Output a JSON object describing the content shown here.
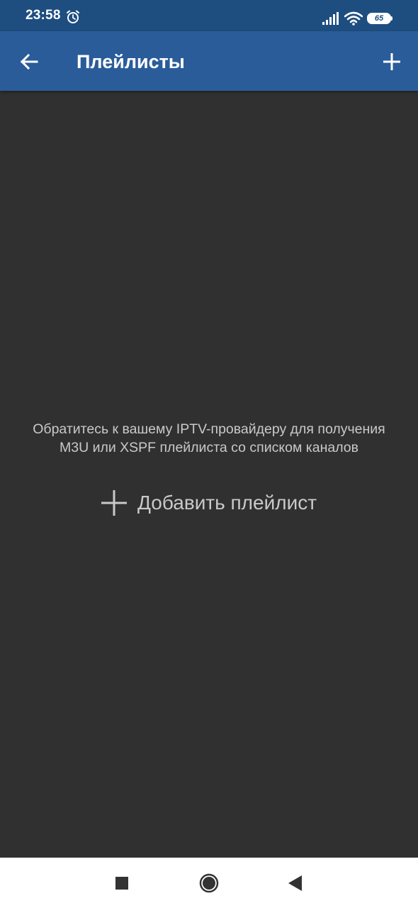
{
  "status_bar": {
    "time": "23:58",
    "battery_level": "65",
    "icons": [
      "alarm-icon",
      "signal-icon",
      "wifi-icon",
      "battery-icon"
    ]
  },
  "app_bar": {
    "title": "Плейлисты",
    "back_icon": "arrow-left-icon",
    "add_icon": "plus-icon"
  },
  "main": {
    "empty_message_line1": "Обратитесь к вашему IPTV-провайдеру для получения",
    "empty_message_line2": "M3U или XSPF плейлиста со списком каналов",
    "add_playlist_label": "Добавить плейлист"
  },
  "nav_bar": {
    "icons": [
      "recents-icon",
      "home-icon",
      "back-triangle-icon"
    ]
  },
  "colors": {
    "status_bar": "#1e4d80",
    "app_bar": "#2a5c9a",
    "background": "#303030",
    "text_secondary": "#c9c9c9",
    "nav_bar": "#ffffff"
  }
}
